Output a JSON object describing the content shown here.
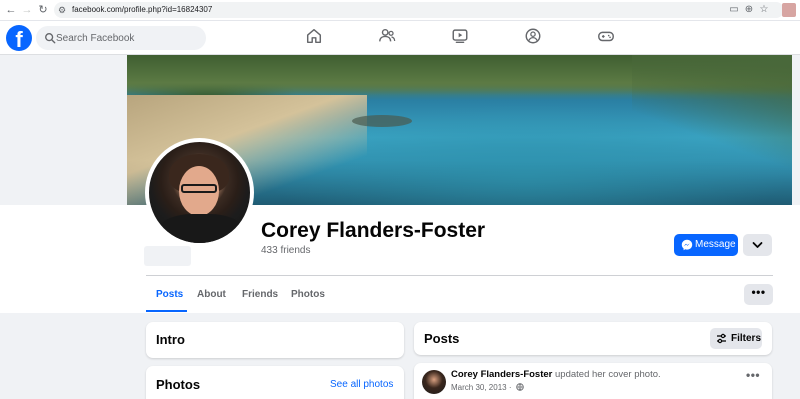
{
  "browser": {
    "url": "facebook.com/profile.php?id=16824307"
  },
  "header": {
    "search_placeholder": "Search Facebook",
    "logo_letter": "f",
    "tabs": [
      {
        "icon": "home-icon"
      },
      {
        "icon": "friends-icon"
      },
      {
        "icon": "video-icon"
      },
      {
        "icon": "groups-icon"
      },
      {
        "icon": "gaming-icon"
      }
    ]
  },
  "profile": {
    "name": "Corey Flanders-Foster",
    "friends": "433 friends",
    "message_label": "Message",
    "more_label": "•••"
  },
  "tabs": [
    {
      "label": "Posts",
      "active": true
    },
    {
      "label": "About",
      "active": false
    },
    {
      "label": "Friends",
      "active": false
    },
    {
      "label": "Photos",
      "active": false
    }
  ],
  "intro": {
    "title": "Intro"
  },
  "photos": {
    "title": "Photos",
    "see_all": "See all photos"
  },
  "posts": {
    "title": "Posts",
    "filters_label": "Filters",
    "items": [
      {
        "author": "Corey Flanders-Foster",
        "action": "updated her cover photo.",
        "date": "March 30, 2013 ·",
        "more": "•••"
      }
    ]
  },
  "colors": {
    "brand": "#0866ff",
    "page_bg": "#f0f2f5",
    "secondary_text": "#65676b"
  }
}
